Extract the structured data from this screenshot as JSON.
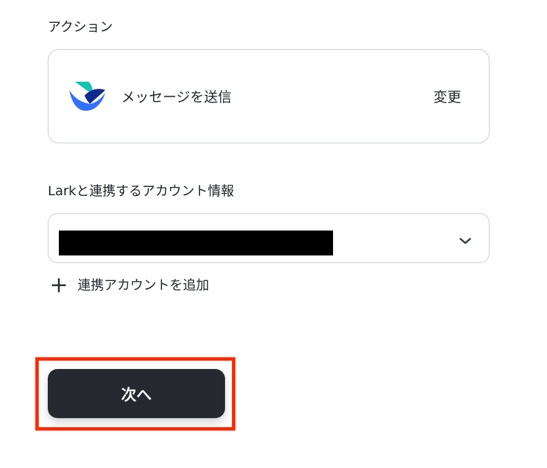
{
  "action_section": {
    "title": "アクション",
    "app_icon": "lark-icon",
    "action_label": "メッセージを送信",
    "change_label": "変更"
  },
  "account_section": {
    "title": "Larkと連携するアカウント情報",
    "selected_value": "",
    "dropdown_icon": "chevron-down-icon",
    "add_icon": "plus-icon",
    "add_label": "連携アカウントを追加"
  },
  "footer": {
    "next_label": "次へ",
    "highlight_color": "#ff2a00"
  },
  "colors": {
    "button_bg": "#262a30",
    "border": "#c9cbcf",
    "lark_teal": "#14c4b0",
    "lark_blue": "#3370ff",
    "lark_navy": "#0f2a8c"
  }
}
